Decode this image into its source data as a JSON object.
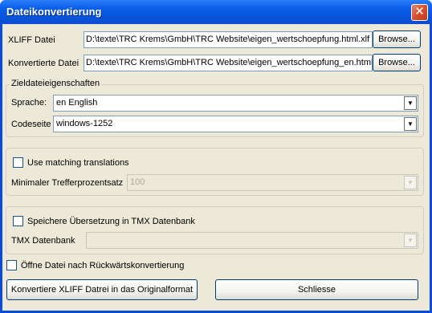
{
  "window": {
    "title": "Dateikonvertierung",
    "close_icon": "close-icon"
  },
  "xliff": {
    "label": "XLIFF Datei",
    "value": "D:\\texte\\TRC Krems\\GmbH\\TRC Website\\eigen_wertschoepfung.html.xlf",
    "browse_label": "Browse..."
  },
  "converted": {
    "label": "Konvertierte Datei",
    "value": "D:\\texte\\TRC Krems\\GmbH\\TRC Website\\eigen_wertschoepfung_en.html",
    "browse_label": "Browse..."
  },
  "target_props": {
    "group_title": "Zieldateieigenschaften",
    "language_label": "Sprache:",
    "language_value": "en English",
    "codepage_label": "Codeseite",
    "codepage_value": "windows-1252"
  },
  "matching": {
    "checkbox_label": "Use matching translations",
    "checked": false,
    "min_match_label": "Minimaler Trefferprozentsatz",
    "min_match_value": "100"
  },
  "tmx": {
    "checkbox_label": "Speichere Übersetzung in TMX Datenbank",
    "checked": false,
    "db_label": "TMX Datenbank",
    "db_value": ""
  },
  "open_after": {
    "checkbox_label": "Öffne Datei nach Rückwärtskonvertierung",
    "checked": false
  },
  "actions": {
    "convert_label": "Konvertiere XLIFF Datrei in das Originalformat",
    "close_label": "Schliesse"
  }
}
